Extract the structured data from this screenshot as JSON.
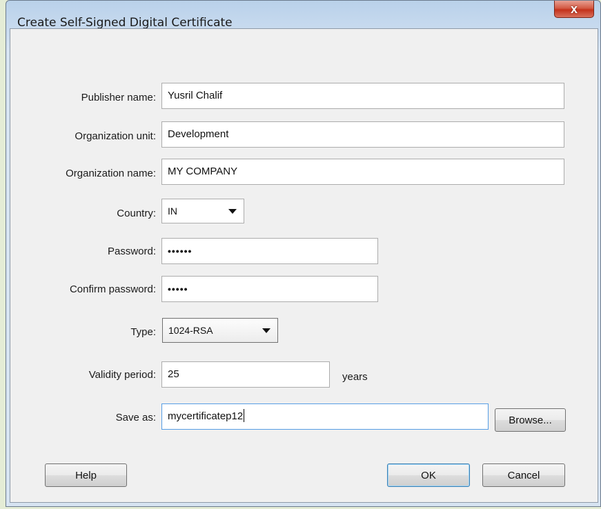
{
  "window": {
    "title": "Create Self-Signed Digital Certificate",
    "close_label": "x"
  },
  "form": {
    "publisher_label": "Publisher name:",
    "publisher_value": "Yusril Chalif",
    "org_unit_label": "Organization unit:",
    "org_unit_value": "Development",
    "org_name_label": "Organization name:",
    "org_name_value": "MY COMPANY",
    "country_label": "Country:",
    "country_value": "IN",
    "password_label": "Password:",
    "password_value": "••••••",
    "confirm_label": "Confirm password:",
    "confirm_value": "•••••",
    "type_label": "Type:",
    "type_value": "1024-RSA",
    "validity_label": "Validity period:",
    "validity_value": "25",
    "validity_unit": "years",
    "save_label": "Save as:",
    "save_value": "mycertificatep12"
  },
  "buttons": {
    "browse": "Browse...",
    "help": "Help",
    "ok": "OK",
    "cancel": "Cancel"
  }
}
